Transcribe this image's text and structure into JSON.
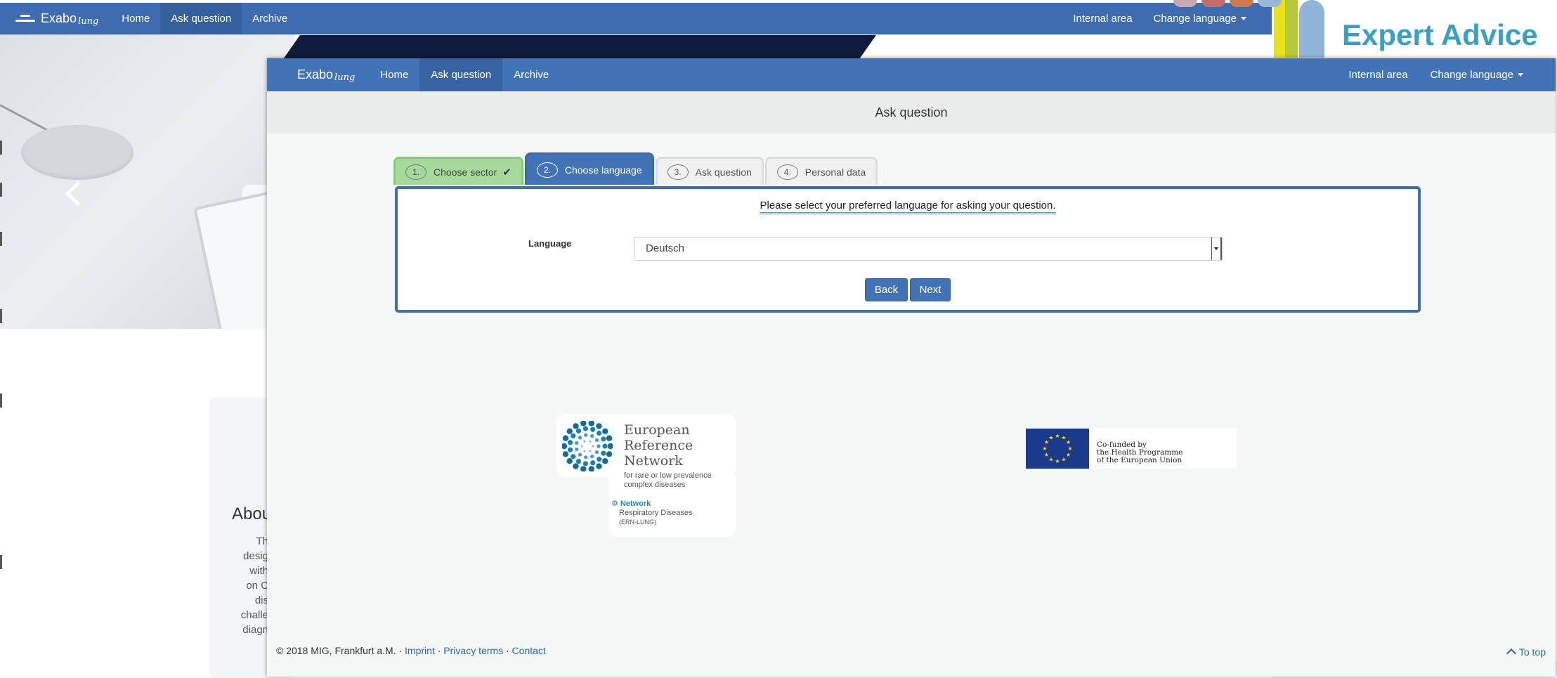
{
  "background_page": {
    "brand": {
      "name": "Exabo",
      "sub": "lung"
    },
    "nav": {
      "home": "Home",
      "ask_question": "Ask question",
      "archive": "Archive",
      "internal_area": "Internal area",
      "change_language": "Change language"
    },
    "expert_advice": "Expert Advice",
    "about": {
      "title": "Abou",
      "lines": [
        "Th",
        "desig",
        "with",
        "on C",
        "dis",
        "challe",
        "diagn"
      ]
    }
  },
  "window": {
    "brand": {
      "name": "Exabo",
      "sub": "lung"
    },
    "nav": {
      "home": "Home",
      "ask_question": "Ask question",
      "archive": "Archive",
      "internal_area": "Internal area",
      "change_language": "Change language"
    },
    "page_title": "Ask question",
    "steps": [
      {
        "num": "1.",
        "label": "Choose sector",
        "state": "done"
      },
      {
        "num": "2.",
        "label": "Choose language",
        "state": "active"
      },
      {
        "num": "3.",
        "label": "Ask question",
        "state": "todo"
      },
      {
        "num": "4.",
        "label": "Personal data",
        "state": "todo"
      }
    ],
    "form": {
      "prompt": "Please select your preferred language for asking your question.",
      "language_label": "Language",
      "language_value": "Deutsch",
      "back_label": "Back",
      "next_label": "Next"
    },
    "ern_logo": {
      "title_lines": [
        "European",
        "Reference",
        "Network"
      ],
      "sub_lines": [
        "for rare or low prevalence",
        "complex diseases"
      ],
      "network": "Network",
      "network_lines": [
        "Respiratory Diseases",
        "(ERN-LUNG)"
      ]
    },
    "eu_logo": {
      "lines": [
        "Co-funded by",
        "the Health Programme",
        "of the European Union"
      ]
    },
    "footer": {
      "copyright": "© 2018 MIG, Frankfurt a.M. · ",
      "imprint": "Imprint",
      "sep1": " · ",
      "privacy": "Privacy terms",
      "sep2": " · ",
      "contact": "Contact",
      "to_top": "To top"
    }
  },
  "colors": {
    "nav_blue": "#4173b6",
    "tab_done_green": "#a6d99c",
    "panel_border": "#3f6eb4",
    "link": "#2c67b5"
  },
  "icons": [
    "hamburger-icon",
    "caret-down-icon",
    "chevron-left-icon",
    "check-icon",
    "select-arrow-icon",
    "chevron-up-icon"
  ]
}
